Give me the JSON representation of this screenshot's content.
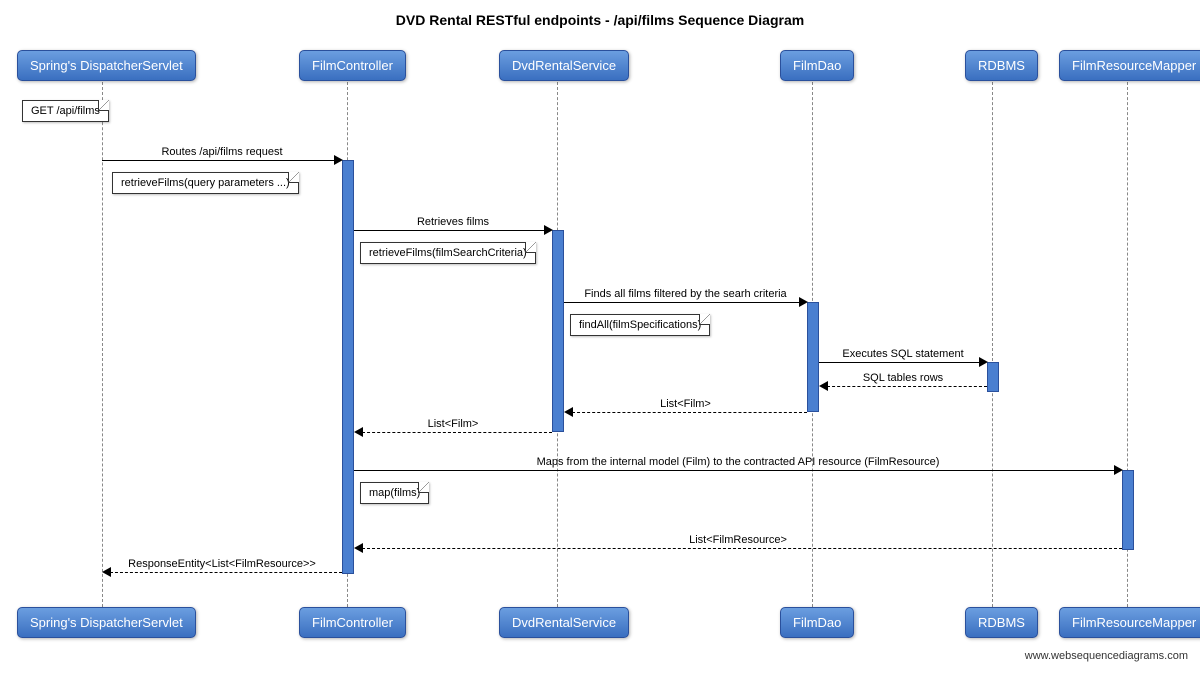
{
  "title": "DVD Rental RESTful endpoints - /api/films Sequence Diagram",
  "participants": {
    "p1": "Spring's DispatcherServlet",
    "p2": "FilmController",
    "p3": "DvdRentalService",
    "p4": "FilmDao",
    "p5": "RDBMS",
    "p6": "FilmResourceMapper"
  },
  "notes": {
    "n1": "GET /api/films",
    "n2": "retrieveFilms(query parameters ...)",
    "n3": "retrieveFilms(filmSearchCriteria)",
    "n4": "findAll(filmSpecifications)",
    "n5": "map(films)"
  },
  "messages": {
    "m1": "Routes /api/films request",
    "m2": "Retrieves films",
    "m3": "Finds all films filtered by the searh criteria",
    "m4": "Executes SQL statement",
    "m5": "SQL tables rows",
    "m6": "List<Film>",
    "m7": "List<Film>",
    "m8": "Maps from the internal model (Film) to the contracted API resource (FilmResource)",
    "m9": "List<FilmResource>",
    "m10": "ResponseEntity<List<FilmResource>>"
  },
  "watermark": "www.websequencediagrams.com"
}
